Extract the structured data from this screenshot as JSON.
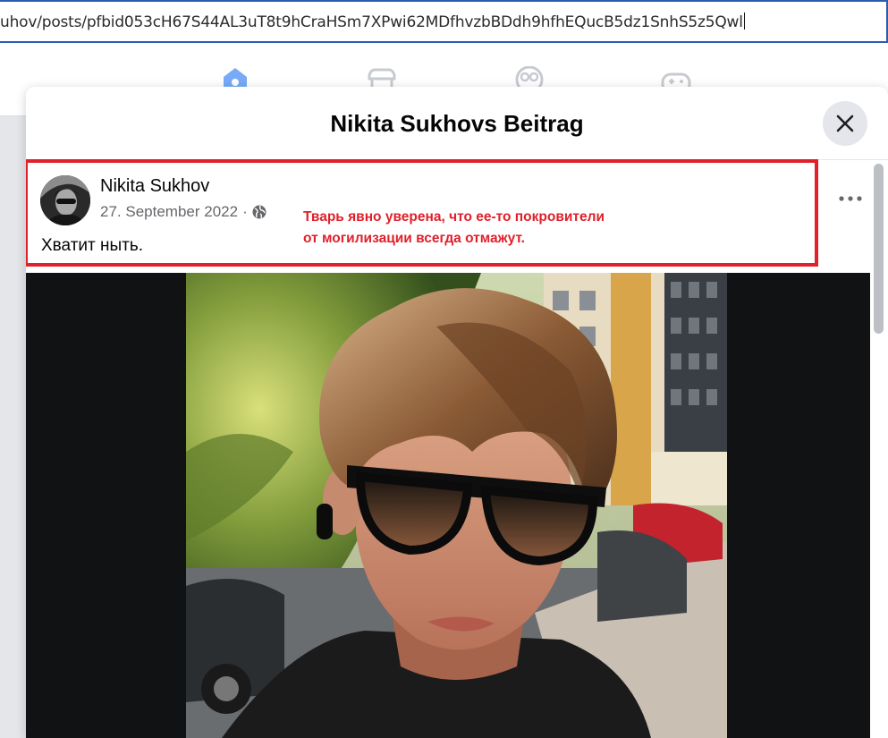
{
  "browser": {
    "url": "uhov/posts/pfbid053cH67S44AL3uT8t9hCraHSm7XPwi62MDfhvzbBDdh9hfhEQucB5dz1SnhS5z5Qwl"
  },
  "nav": {
    "icons": [
      "home-icon",
      "marketplace-icon",
      "groups-icon",
      "gaming-icon"
    ],
    "accent": "#1877f2",
    "inactive": "#c7cbd1"
  },
  "modal": {
    "title": "Nikita Sukhovs Beitrag",
    "close_icon": "close-icon"
  },
  "post": {
    "author": "Nikita Sukhov",
    "date": "27. September 2022",
    "separator": "·",
    "audience_icon": "globe-icon",
    "text": "Хватит ныть.",
    "more_icon": "more-horizontal-icon"
  },
  "annotation": {
    "line1": "Тварь явно уверена, что ее-то покровители",
    "line2": "от могилизации всегда отмажут.",
    "color": "#e0202b"
  }
}
